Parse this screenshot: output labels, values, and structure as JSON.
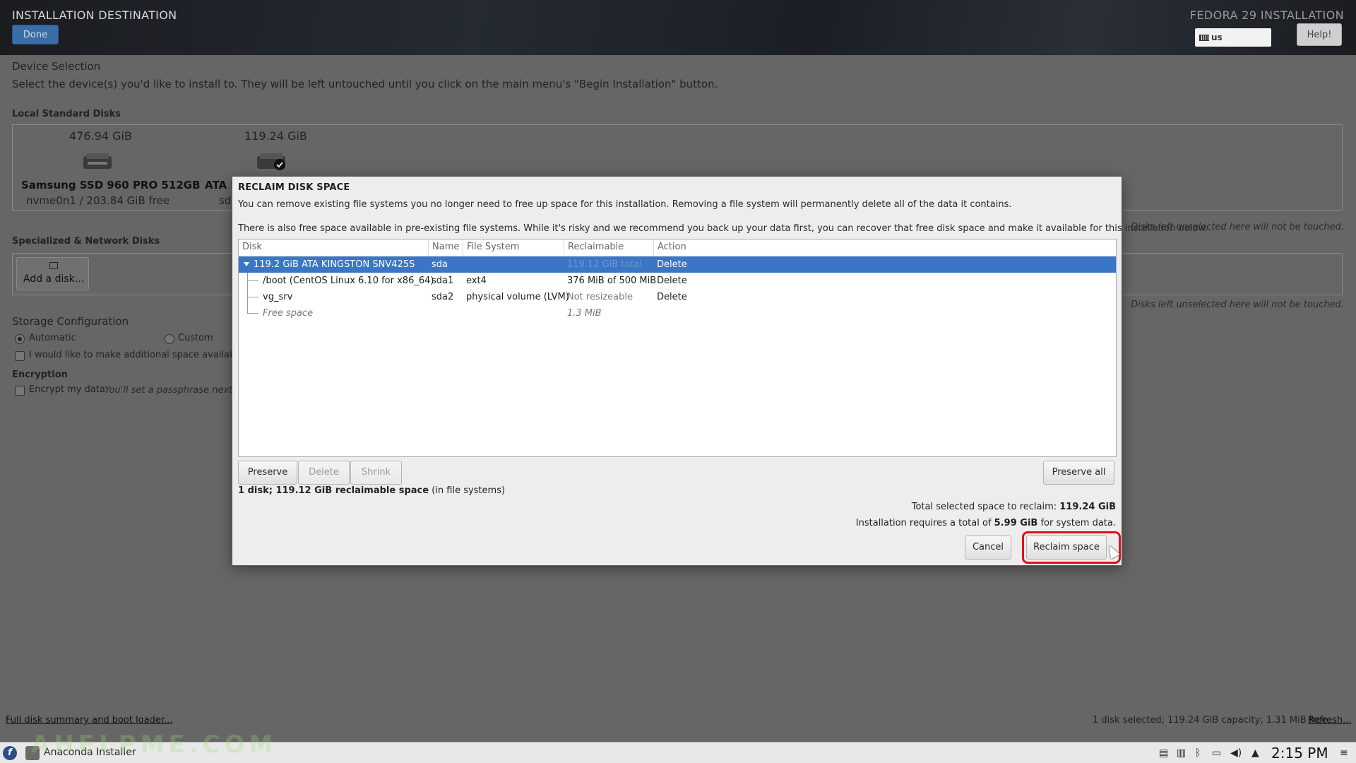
{
  "header": {
    "title": "INSTALLATION DESTINATION",
    "done_label": "Done",
    "product": "FEDORA 29 INSTALLATION",
    "keyboard": "us",
    "help_label": "Help!"
  },
  "device_selection": {
    "heading": "Device Selection",
    "description": "Select the device(s) you'd like to install to.  They will be left untouched until you click on the main menu's \"Begin Installation\" button.",
    "local_heading": "Local Standard Disks",
    "disks": [
      {
        "size": "476.94 GiB",
        "name": "Samsung SSD 960 PRO 512GB",
        "sub": "nvme0n1  /  203.84 GiB free"
      },
      {
        "size": "119.24 GiB",
        "name": "ATA I",
        "sub": "sd"
      }
    ],
    "untouched_note_1": "Disks left unselected here will not be touched.",
    "network_heading": "Specialized & Network Disks",
    "add_disk_label": "Add a disk...",
    "untouched_note_2": "Disks left unselected here will not be touched."
  },
  "storage": {
    "heading": "Storage Configuration",
    "automatic": "Automatic",
    "custom": "Custom",
    "additional_space": "I would like to make additional space available.",
    "encryption_heading": "Encryption",
    "encrypt_label": "Encrypt my data.",
    "encrypt_hint": "You'll set a passphrase next."
  },
  "footer": {
    "summary_link": "Full disk summary and boot loader...",
    "status": "1 disk selected; 119.24 GiB capacity; 1.31 MiB free",
    "refresh": "Refresh..."
  },
  "dialog": {
    "title": "RECLAIM DISK SPACE",
    "line1": "You can remove existing file systems you no longer need to free up space for this installation.  Removing a file system will permanently delete all of the data it contains.",
    "line2": "There is also free space available in pre-existing file systems.  While it's risky and we recommend you back up your data first, you can recover that free disk space and make it available for this installation below.",
    "columns": [
      "Disk",
      "Name",
      "File System",
      "Reclaimable Space",
      "Action"
    ],
    "rows": [
      {
        "disk": "119.2 GiB ATA KINGSTON SNV425S",
        "name": "sda",
        "fs": "",
        "reclaim": "119.12 GiB total",
        "action": "Delete",
        "selected": true
      },
      {
        "disk": "/boot (CentOS Linux 6.10 for x86_64)",
        "name": "sda1",
        "fs": "ext4",
        "reclaim": "376 MiB of 500 MiB",
        "action": "Delete"
      },
      {
        "disk": "vg_srv",
        "name": "sda2",
        "fs": "physical volume (LVM)",
        "reclaim": "Not resizeable",
        "action": "Delete"
      },
      {
        "disk": "Free space",
        "name": "",
        "fs": "",
        "reclaim": "1.3 MiB",
        "action": ""
      }
    ],
    "preserve_label": "Preserve",
    "delete_label": "Delete",
    "shrink_label": "Shrink",
    "preserve_all_label": "Preserve all",
    "summary_bold": "1 disk; 119.12 GiB reclaimable space",
    "summary_rest": " (in file systems)",
    "total_prefix": "Total selected space to reclaim: ",
    "total_value": "119.24 GiB",
    "requires_prefix": "Installation requires a total of ",
    "requires_value": "5.99 GiB",
    "requires_suffix": " for system data.",
    "cancel_label": "Cancel",
    "reclaim_label": "Reclaim space"
  },
  "taskbar": {
    "app_name": "Anaconda Installer",
    "clock": "2:15 PM",
    "watermark": "AHELPME.COM"
  }
}
